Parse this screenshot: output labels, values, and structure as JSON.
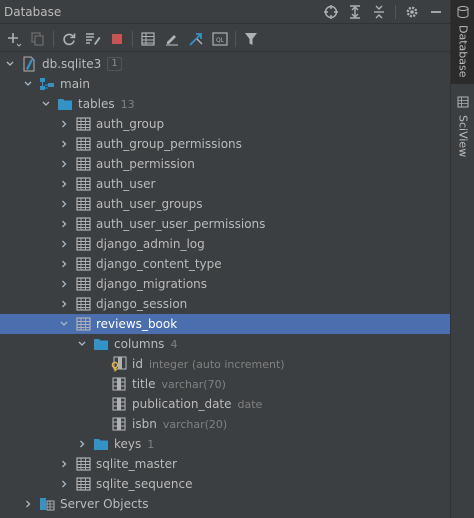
{
  "panel": {
    "title": "Database"
  },
  "sidebar": {
    "tabs": [
      {
        "label": "Database"
      },
      {
        "label": "SciView"
      }
    ]
  },
  "tree": {
    "datasource": {
      "label": "db.sqlite3",
      "badge": "1"
    },
    "schema": {
      "label": "main"
    },
    "tables": {
      "label": "tables",
      "count": "13"
    },
    "table_items": [
      {
        "label": "auth_group"
      },
      {
        "label": "auth_group_permissions"
      },
      {
        "label": "auth_permission"
      },
      {
        "label": "auth_user"
      },
      {
        "label": "auth_user_groups"
      },
      {
        "label": "auth_user_user_permissions"
      },
      {
        "label": "django_admin_log"
      },
      {
        "label": "django_content_type"
      },
      {
        "label": "django_migrations"
      },
      {
        "label": "django_session"
      },
      {
        "label": "reviews_book"
      }
    ],
    "columns": {
      "label": "columns",
      "count": "4"
    },
    "column_items": [
      {
        "name": "id",
        "type": "integer (auto increment)"
      },
      {
        "name": "title",
        "type": "varchar(70)"
      },
      {
        "name": "publication_date",
        "type": "date"
      },
      {
        "name": "isbn",
        "type": "varchar(20)"
      }
    ],
    "keys": {
      "label": "keys",
      "count": "1"
    },
    "after_items": [
      {
        "label": "sqlite_master"
      },
      {
        "label": "sqlite_sequence"
      }
    ],
    "server_objects": {
      "label": "Server Objects"
    }
  },
  "colors": {
    "background": "#3c3f41",
    "selection": "#4b6eaf",
    "folder": "#3592c4",
    "stop": "#c75450",
    "accent_blue": "#3592c4"
  }
}
